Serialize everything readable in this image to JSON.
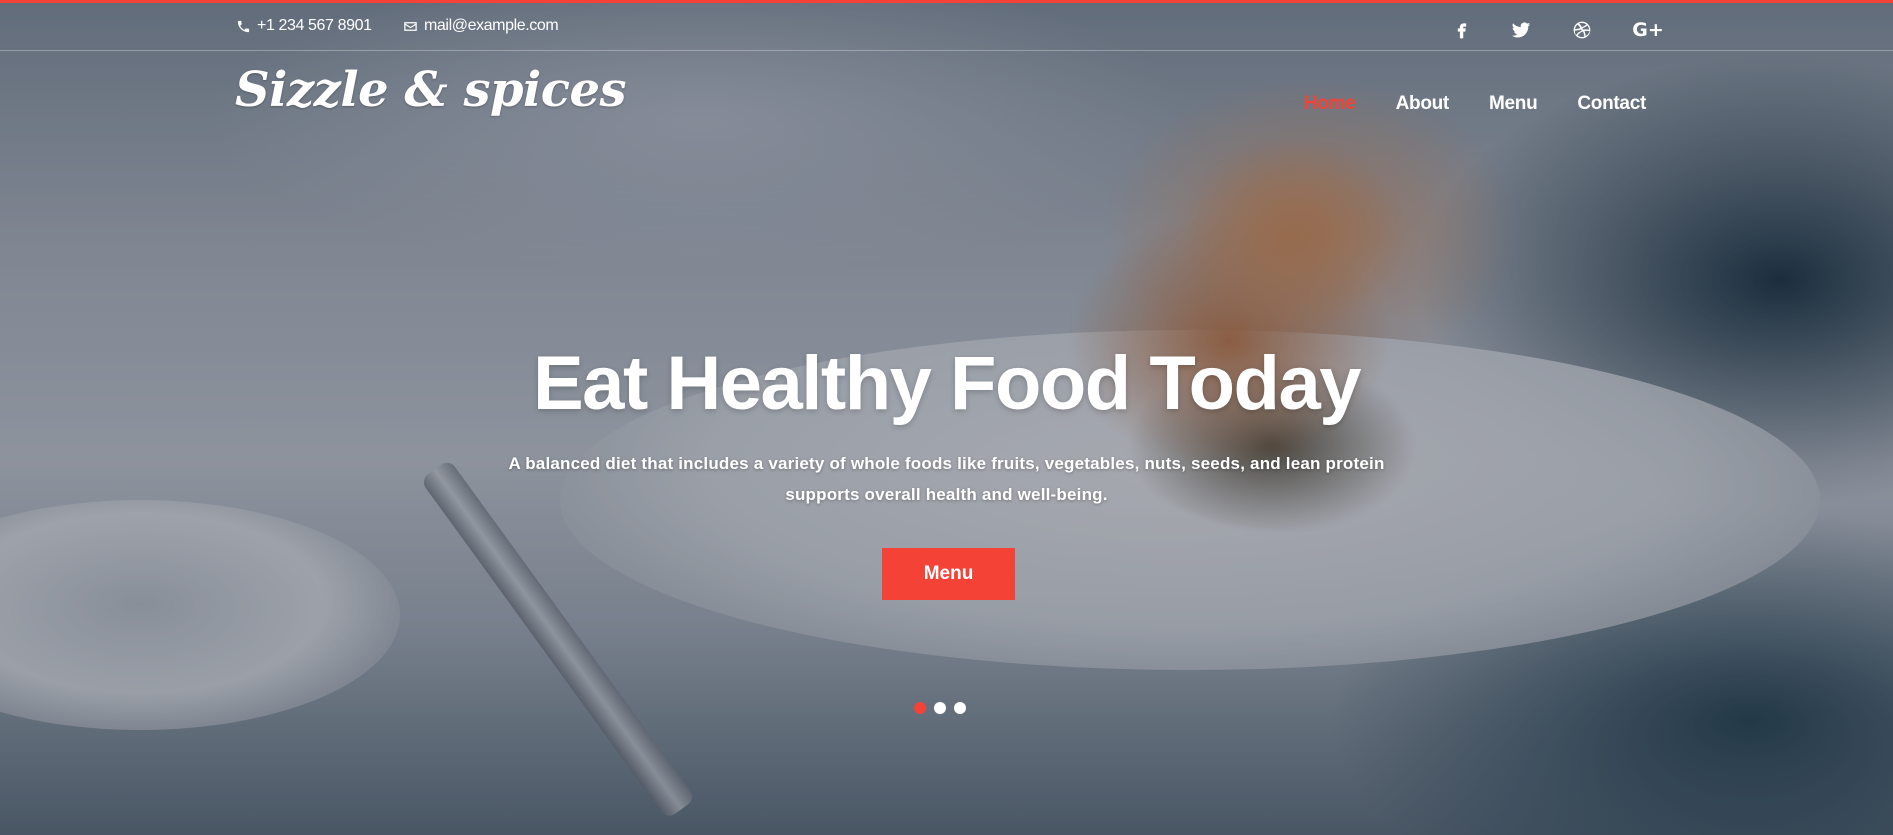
{
  "topbar": {
    "phone": "+1 234 567 8901",
    "email": "mail@example.com",
    "social": [
      "facebook-icon",
      "twitter-icon",
      "dribbble-icon",
      "google-plus-icon"
    ],
    "google_plus_label": "G+"
  },
  "header": {
    "logo": "Sizzle & spices",
    "nav": [
      {
        "label": "Home",
        "active": true
      },
      {
        "label": "About",
        "active": false
      },
      {
        "label": "Menu",
        "active": false
      },
      {
        "label": "Contact",
        "active": false
      }
    ]
  },
  "hero": {
    "title": "Eat Healthy Food Today",
    "subtitle_line1": "A balanced diet that includes a variety of whole foods like fruits, vegetables, nuts, seeds, and lean protein",
    "subtitle_line2": "supports overall health and well-being.",
    "button_label": "Menu",
    "slides": 3,
    "active_slide": 1
  },
  "colors": {
    "accent": "#f44336",
    "text": "#ffffff"
  }
}
